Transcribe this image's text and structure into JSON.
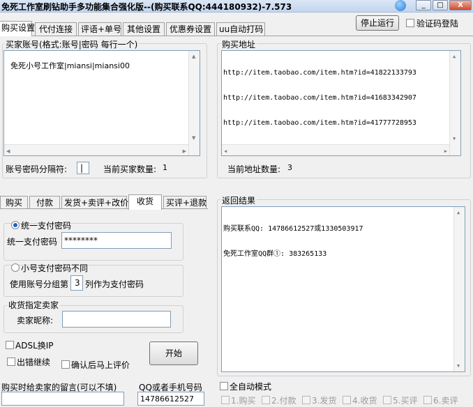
{
  "window": {
    "title": "免死工作室刷钻助手多功能集合强化版--(购买联系QQ:444180932)-7.573",
    "controls": [
      "_",
      "□",
      "X"
    ]
  },
  "main_tabs": [
    {
      "label": "购买设置",
      "active": true
    },
    {
      "label": "代付连接",
      "active": false
    },
    {
      "label": "评语+单号",
      "active": false
    },
    {
      "label": "其他设置",
      "active": false
    },
    {
      "label": "优惠券设置",
      "active": false
    },
    {
      "label": "uu自动打码",
      "active": false
    }
  ],
  "toolbar": {
    "stop_label": "停止运行",
    "captcha_login_label": "验证码登陆"
  },
  "buyer_accounts": {
    "group_title": "买家账号(格式:账号|密码 每行一个)",
    "text": "免死小号工作室|miansi|miansi00",
    "separator_label": "账号密码分隔符:",
    "separator_value": "|",
    "count_label": "当前买家数量:",
    "count_value": "1"
  },
  "buy_urls": {
    "group_title": "购买地址",
    "lines": [
      "http://item.taobao.com/item.htm?id=41822133793",
      "http://item.taobao.com/item.htm?id=41683342907",
      "http://item.taobao.com/item.htm?id=41777728953"
    ],
    "count_label": "当前地址数量:",
    "count_value": "3"
  },
  "sub_tabs": [
    {
      "label": "购买",
      "active": false
    },
    {
      "label": "付款",
      "active": false
    },
    {
      "label": "发货+卖评+改价",
      "active": false
    },
    {
      "label": "收货",
      "active": true
    },
    {
      "label": "买评+退款",
      "active": false
    }
  ],
  "receive": {
    "unified_pwd_radio": "统一支付密码",
    "unified_pwd_label": "统一支付密码",
    "unified_pwd_value": "********",
    "diff_pwd_radio": "小号支付密码不同",
    "use_group_prefix": "使用账号分组第",
    "use_group_value": "3",
    "use_group_suffix": "列作为支付密码",
    "seller_group_title": "收货指定卖家",
    "seller_nick_label": "卖家昵称:",
    "seller_nick_value": "",
    "adsl_label": "ADSL换IP",
    "continue_on_error_label": "出错继续",
    "confirm_review_label": "确认后马上评价",
    "start_label": "开始"
  },
  "result": {
    "group_title": "返回结果",
    "lines": [
      "购买联系QQ: 14786612527或1330503917",
      "免死工作室QQ群①: 383265133"
    ]
  },
  "bottom": {
    "message_label": "购买时给卖家的留言(可以不填)",
    "message_value": "",
    "qq_label": "QQ或者手机号码",
    "qq_value": "14786612527",
    "auto_mode_label": "全自动模式",
    "steps": [
      "1.购买",
      "2.付款",
      "3.发货",
      "4.收货",
      "5.买评",
      "6.卖评"
    ]
  }
}
